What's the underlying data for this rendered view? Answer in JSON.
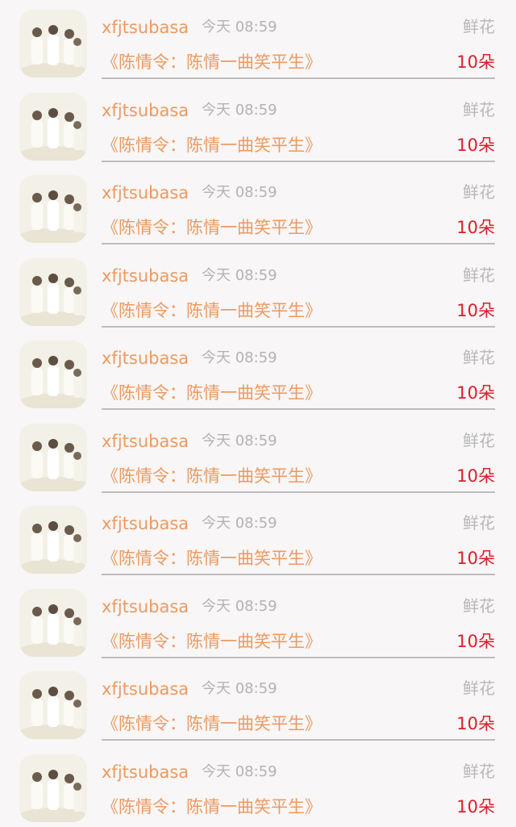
{
  "gift_records": [
    {
      "username": "xfjtsubasa",
      "time": "今天 08:59",
      "gift_name": "鲜花",
      "work_title": "《陈情令：陈情一曲笑平生》",
      "count": "10朵"
    },
    {
      "username": "xfjtsubasa",
      "time": "今天 08:59",
      "gift_name": "鲜花",
      "work_title": "《陈情令：陈情一曲笑平生》",
      "count": "10朵"
    },
    {
      "username": "xfjtsubasa",
      "time": "今天 08:59",
      "gift_name": "鲜花",
      "work_title": "《陈情令：陈情一曲笑平生》",
      "count": "10朵"
    },
    {
      "username": "xfjtsubasa",
      "time": "今天 08:59",
      "gift_name": "鲜花",
      "work_title": "《陈情令：陈情一曲笑平生》",
      "count": "10朵"
    },
    {
      "username": "xfjtsubasa",
      "time": "今天 08:59",
      "gift_name": "鲜花",
      "work_title": "《陈情令：陈情一曲笑平生》",
      "count": "10朵"
    },
    {
      "username": "xfjtsubasa",
      "time": "今天 08:59",
      "gift_name": "鲜花",
      "work_title": "《陈情令：陈情一曲笑平生》",
      "count": "10朵"
    },
    {
      "username": "xfjtsubasa",
      "time": "今天 08:59",
      "gift_name": "鲜花",
      "work_title": "《陈情令：陈情一曲笑平生》",
      "count": "10朵"
    },
    {
      "username": "xfjtsubasa",
      "time": "今天 08:59",
      "gift_name": "鲜花",
      "work_title": "《陈情令：陈情一曲笑平生》",
      "count": "10朵"
    },
    {
      "username": "xfjtsubasa",
      "time": "今天 08:59",
      "gift_name": "鲜花",
      "work_title": "《陈情令：陈情一曲笑平生》",
      "count": "10朵"
    },
    {
      "username": "xfjtsubasa",
      "time": "今天 08:59",
      "gift_name": "鲜花",
      "work_title": "《陈情令：陈情一曲笑平生》",
      "count": "10朵"
    }
  ],
  "colors": {
    "username": "#ec9a62",
    "count": "#d6202c",
    "muted": "#b3b3b3",
    "divider": "#bdbdbd",
    "background": "#f8f6f6"
  }
}
